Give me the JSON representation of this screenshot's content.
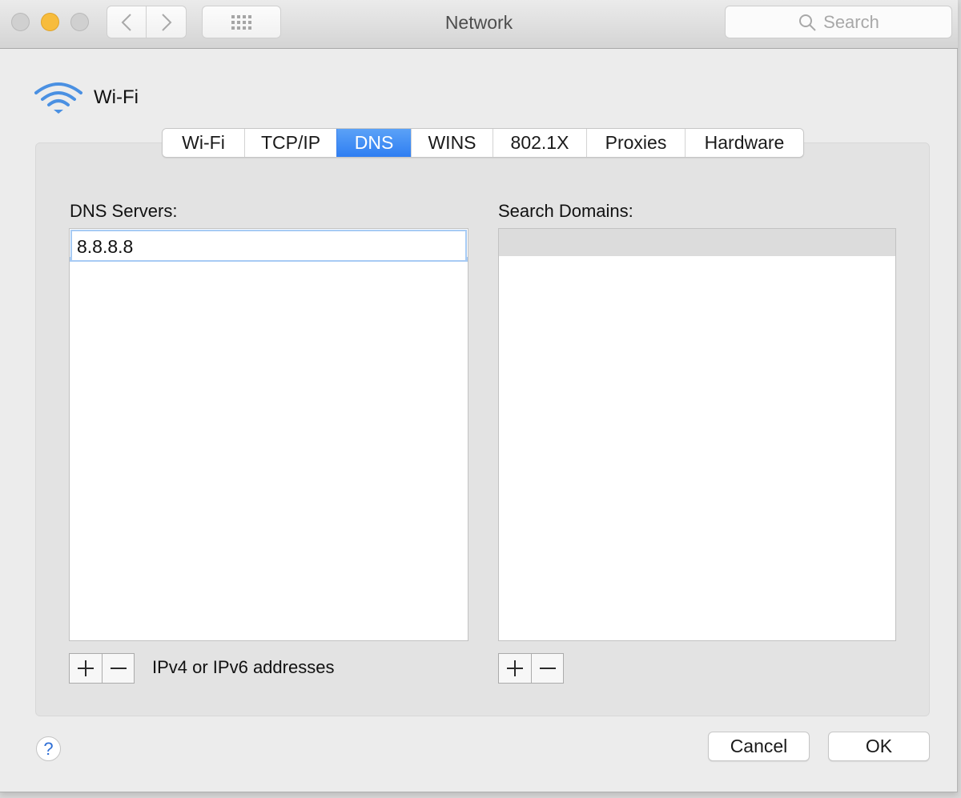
{
  "window": {
    "title": "Network",
    "search_placeholder": "Search",
    "nav": {
      "back_icon": "chevron-left-icon",
      "forward_icon": "chevron-right-icon",
      "grid_icon": "show-all-grid-icon"
    }
  },
  "header": {
    "icon": "wifi-icon",
    "title": "Wi-Fi"
  },
  "tabs": [
    {
      "label": "Wi-Fi",
      "active": false
    },
    {
      "label": "TCP/IP",
      "active": false
    },
    {
      "label": "DNS",
      "active": true
    },
    {
      "label": "WINS",
      "active": false
    },
    {
      "label": "802.1X",
      "active": false
    },
    {
      "label": "Proxies",
      "active": false
    },
    {
      "label": "Hardware",
      "active": false
    }
  ],
  "dns": {
    "label": "DNS Servers:",
    "servers": [
      "8.8.8.8"
    ],
    "add_label": "+",
    "remove_label": "−",
    "hint": "IPv4 or IPv6 addresses"
  },
  "search_domains": {
    "label": "Search Domains:",
    "domains": [],
    "add_label": "+",
    "remove_label": "−"
  },
  "footer": {
    "help_label": "?",
    "cancel_label": "Cancel",
    "ok_label": "OK"
  },
  "colors": {
    "accent": "#2f7ef2",
    "selection": "#a7cbf4",
    "minimize": "#f7bc3c"
  }
}
